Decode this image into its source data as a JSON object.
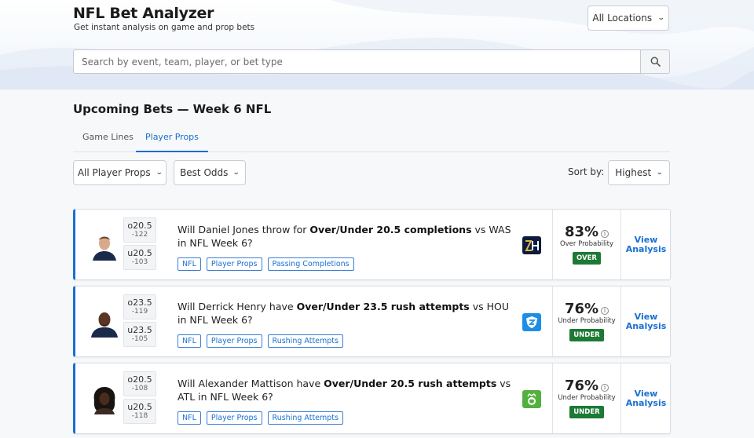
{
  "header": {
    "title": "NFL Bet Analyzer",
    "subtitle": "Get instant analysis on game and prop bets",
    "location_select": "All Locations",
    "search_placeholder": "Search by event, team, player, or bet type"
  },
  "section": {
    "title": "Upcoming Bets — Week 6 NFL"
  },
  "tabs": [
    {
      "label": "Game Lines",
      "active": false
    },
    {
      "label": "Player Props",
      "active": true
    }
  ],
  "filters": {
    "prop_type": "All Player Props",
    "odds": "Best Odds",
    "sort_label": "Sort by:",
    "sort_value": "Highest"
  },
  "colors": {
    "accent": "#1a6fd0",
    "verdict_green": "#1c7a35"
  },
  "bets": [
    {
      "player_icon": "player-avatar",
      "over_line": "o20.5",
      "over_odds": "-122",
      "under_line": "u20.5",
      "under_odds": "-103",
      "question_pre": "Will Daniel Jones throw for ",
      "question_bold": "Over/Under 20.5 completions",
      "question_post": " vs WAS in NFL Week 6?",
      "tags": [
        "NFL",
        "Player Props",
        "Passing Completions"
      ],
      "book_icon": "sportsbook-logo-zh",
      "probability": "83%",
      "probability_label": "Over Probability",
      "verdict": "OVER",
      "cta": "View Analysis"
    },
    {
      "player_icon": "player-avatar",
      "over_line": "o23.5",
      "over_odds": "-119",
      "under_line": "u23.5",
      "under_odds": "-105",
      "question_pre": "Will Derrick Henry have ",
      "question_bold": "Over/Under 23.5 rush attempts",
      "question_post": " vs HOU in NFL Week 6?",
      "tags": [
        "NFL",
        "Player Props",
        "Rushing Attempts"
      ],
      "book_icon": "sportsbook-logo-shield",
      "probability": "76%",
      "probability_label": "Under Probability",
      "verdict": "UNDER",
      "cta": "View Analysis"
    },
    {
      "player_icon": "player-avatar",
      "over_line": "o20.5",
      "over_odds": "-108",
      "under_line": "u20.5",
      "under_odds": "-118",
      "question_pre": "Will Alexander Mattison have ",
      "question_bold": "Over/Under 20.5 rush attempts",
      "question_post": " vs ATL in NFL Week 6?",
      "tags": [
        "NFL",
        "Player Props",
        "Rushing Attempts"
      ],
      "book_icon": "sportsbook-logo-crown",
      "probability": "76%",
      "probability_label": "Under Probability",
      "verdict": "UNDER",
      "cta": "View Analysis"
    }
  ]
}
